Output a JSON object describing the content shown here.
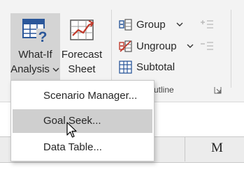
{
  "ribbon": {
    "what_if_line1": "What-If",
    "what_if_line2": "Analysis",
    "forecast_line1": "Forecast",
    "forecast_line2": "Sheet",
    "group_label": "Group",
    "ungroup_label": "Ungroup",
    "subtotal_label": "Subtotal",
    "outline_group_label": "utline"
  },
  "menu": {
    "items": [
      {
        "label": "Scenario Manager..."
      },
      {
        "label": "Goal Seek..."
      },
      {
        "label": "Data Table..."
      }
    ]
  },
  "sheet": {
    "column_m": "M"
  },
  "colors": {
    "accent_blue": "#2b579a",
    "accent_red": "#c0392b",
    "hover_bg": "#cfcfcf"
  }
}
